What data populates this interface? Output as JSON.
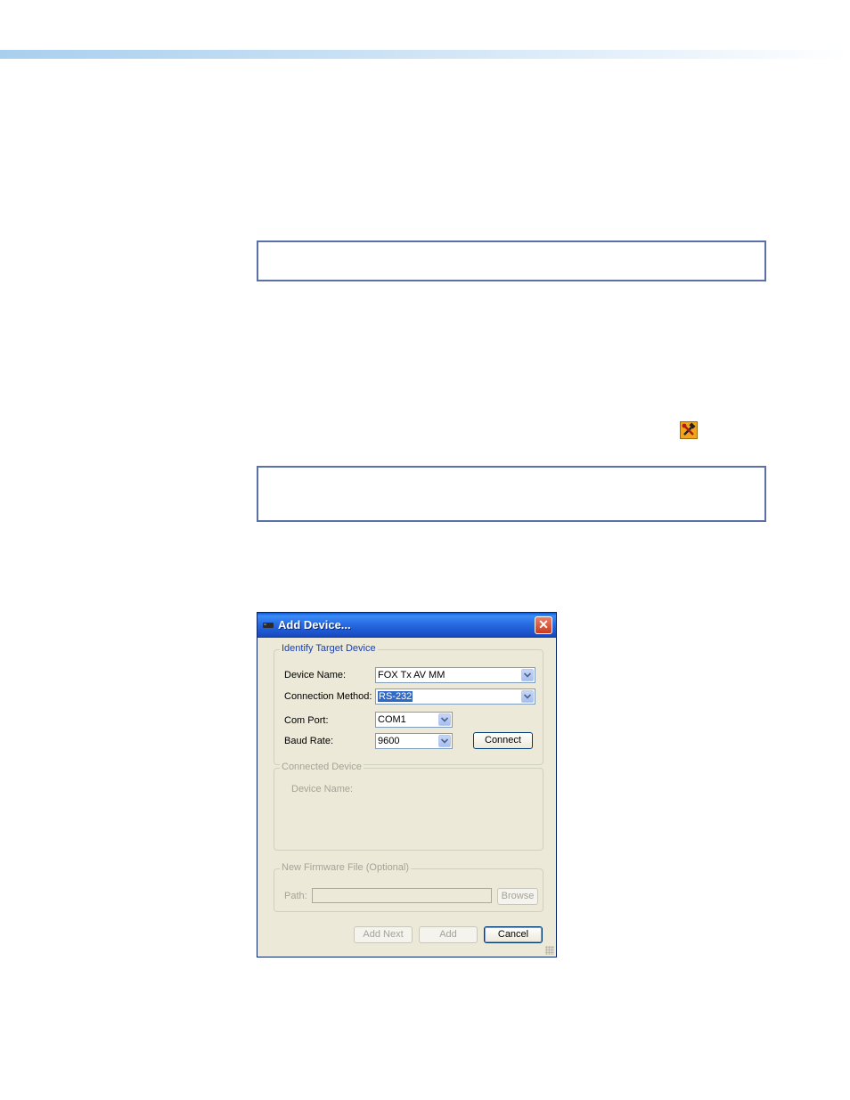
{
  "dialog": {
    "title": "Add Device...",
    "close_glyph": "✕",
    "identify_group": {
      "legend": "Identify Target Device",
      "device_name_label": "Device Name:",
      "device_name_value": "FOX Tx AV MM",
      "connection_method_label": "Connection Method:",
      "connection_method_value": "RS-232",
      "com_port_label": "Com Port:",
      "com_port_value": "COM1",
      "baud_rate_label": "Baud Rate:",
      "baud_rate_value": "9600",
      "connect_label": "Connect"
    },
    "connected_group": {
      "legend": "Connected Device",
      "device_name_label": "Device Name:"
    },
    "firmware_group": {
      "legend": "New Firmware File (Optional)",
      "path_label": "Path:",
      "browse_label": "Browse"
    },
    "buttons": {
      "add_next": "Add Next",
      "add": "Add",
      "cancel": "Cancel"
    }
  },
  "icons": {
    "toolbar_icon": "hammer-wrench-tools-icon",
    "dialog_icon": "device-icon",
    "dropdown_icon": "chevron-down-icon"
  },
  "colors": {
    "titlebar": "#2567e0",
    "dialog_face": "#ece9d8",
    "note_border": "#5b6fa8",
    "selection": "#316ac5"
  }
}
